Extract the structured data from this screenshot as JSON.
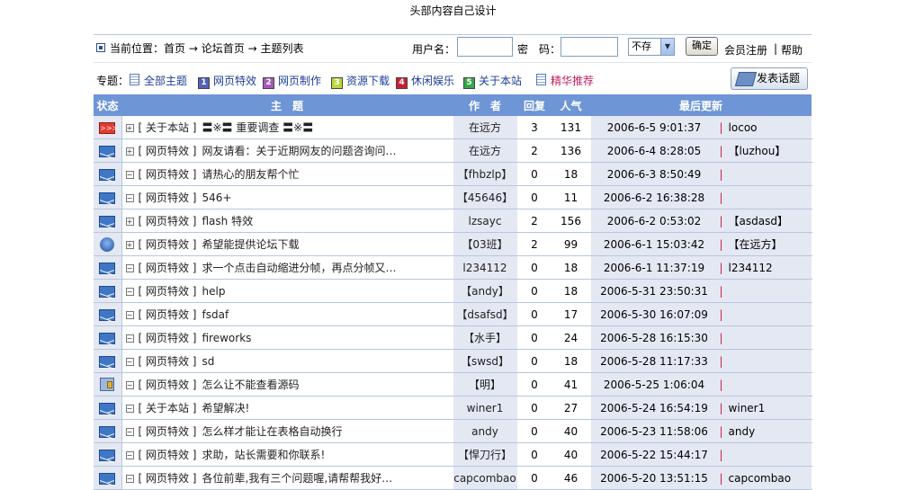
{
  "header": {
    "banner": "头部内容自己设计"
  },
  "nav": {
    "location_label": "当前位置：",
    "home": "首页",
    "arrow": "→",
    "forum_home": "论坛首页",
    "topic_list": "主题列表"
  },
  "login": {
    "username_label": "用户名：",
    "username_value": "",
    "password_label": "密　码：",
    "password_value": "",
    "save_select": "不存",
    "confirm_button": "确定",
    "register_link": "会员注册",
    "divider": "|",
    "help_link": "帮助"
  },
  "topics": {
    "label": "专题：",
    "items": [
      {
        "label": "全部主题",
        "badge": "",
        "color": "#ffffff"
      },
      {
        "label": "网页特效",
        "badge": "1",
        "color": "#5260b8"
      },
      {
        "label": "网页制作",
        "badge": "2",
        "color": "#a45ab9"
      },
      {
        "label": "资源下载",
        "badge": "3",
        "color": "#b8d838"
      },
      {
        "label": "休闲娱乐",
        "badge": "4",
        "color": "#cc2030"
      },
      {
        "label": "关于本站",
        "badge": "5",
        "color": "#36a84a"
      },
      {
        "label": "精华推荐",
        "badge": "",
        "color": "#c02060"
      }
    ],
    "post_button": "发表话题"
  },
  "table": {
    "headers": {
      "status": "状态",
      "subject": "主　题",
      "author": "作　者",
      "replies": "回复",
      "views": "人气",
      "last": "最后更新"
    },
    "rows": [
      {
        "icon": "hot-icon",
        "expand": "+",
        "tag": "[ 关于本站 ]",
        "title": "〓※〓 重要调查 〓※〓",
        "author": "在远方",
        "replies": "3",
        "views": "131",
        "time": "2006-6-5 9:01:37",
        "sep": "|",
        "last_user": "locoo"
      },
      {
        "icon": "mail-icon",
        "expand": "+",
        "tag": "[ 网页特效 ]",
        "title": "网友请看：关于近期网友的问题咨询问…",
        "author": "在远方",
        "replies": "2",
        "views": "136",
        "time": "2006-6-4 8:28:05",
        "sep": "|",
        "last_user": "【luzhou】"
      },
      {
        "icon": "mail-icon",
        "expand": "−",
        "tag": "[ 网页特效 ]",
        "title": "请热心的朋友帮个忙",
        "author": "【fhbzlp】",
        "replies": "0",
        "views": "18",
        "time": "2006-6-3 8:50:49",
        "sep": "|",
        "last_user": ""
      },
      {
        "icon": "mail-icon",
        "expand": "−",
        "tag": "[ 网页特效 ]",
        "title": "546+",
        "author": "【45646】",
        "replies": "0",
        "views": "11",
        "time": "2006-6-2 16:38:28",
        "sep": "|",
        "last_user": ""
      },
      {
        "icon": "mail-icon",
        "expand": "+",
        "tag": "[ 网页特效 ]",
        "title": "flash 特效",
        "author": "lzsayc",
        "replies": "2",
        "views": "156",
        "time": "2006-6-2 0:53:02",
        "sep": "|",
        "last_user": "【asdasd】"
      },
      {
        "icon": "vote-icon",
        "expand": "+",
        "tag": "[ 网页特效 ]",
        "title": "希望能提供论坛下载",
        "author": "【03班】",
        "replies": "2",
        "views": "99",
        "time": "2006-6-1 15:03:42",
        "sep": "|",
        "last_user": "【在远方】"
      },
      {
        "icon": "mail-icon",
        "expand": "−",
        "tag": "[ 网页特效 ]",
        "title": "求一个点击自动缩进分帧，再点分帧又…",
        "author": "l234112",
        "replies": "0",
        "views": "18",
        "time": "2006-6-1 11:37:19",
        "sep": "|",
        "last_user": "l234112"
      },
      {
        "icon": "mail-icon",
        "expand": "−",
        "tag": "[ 网页特效 ]",
        "title": "help",
        "author": "【andy】",
        "replies": "0",
        "views": "18",
        "time": "2006-5-31 23:50:31",
        "sep": "|",
        "last_user": ""
      },
      {
        "icon": "mail-icon",
        "expand": "−",
        "tag": "[ 网页特效 ]",
        "title": "fsdaf",
        "author": "【dsafsd】",
        "replies": "0",
        "views": "17",
        "time": "2006-5-30 16:07:09",
        "sep": "|",
        "last_user": ""
      },
      {
        "icon": "mail-icon",
        "expand": "−",
        "tag": "[ 网页特效 ]",
        "title": "fireworks",
        "author": "【水手】",
        "replies": "0",
        "views": "24",
        "time": "2006-5-28 16:15:30",
        "sep": "|",
        "last_user": ""
      },
      {
        "icon": "mail-icon",
        "expand": "−",
        "tag": "[ 网页特效 ]",
        "title": "sd",
        "author": "【swsd】",
        "replies": "0",
        "views": "18",
        "time": "2006-5-28 11:17:33",
        "sep": "|",
        "last_user": ""
      },
      {
        "icon": "locked-icon",
        "expand": "−",
        "tag": "[ 网页特效 ]",
        "title": "怎么让不能查看源码",
        "author": "【明】",
        "replies": "0",
        "views": "41",
        "time": "2006-5-25 1:06:04",
        "sep": "|",
        "last_user": ""
      },
      {
        "icon": "mail-icon",
        "expand": "−",
        "tag": "[ 关于本站 ]",
        "title": "希望解决!",
        "author": "winer1",
        "replies": "0",
        "views": "27",
        "time": "2006-5-24 16:54:19",
        "sep": "|",
        "last_user": "winer1"
      },
      {
        "icon": "mail-icon",
        "expand": "−",
        "tag": "[ 网页特效 ]",
        "title": "怎么样才能让在表格自动换行",
        "author": "andy",
        "replies": "0",
        "views": "40",
        "time": "2006-5-23 11:58:06",
        "sep": "|",
        "last_user": "andy"
      },
      {
        "icon": "mail-icon",
        "expand": "−",
        "tag": "[ 网页特效 ]",
        "title": "求助，站长需要和你联系!",
        "author": "【悍刀行】",
        "replies": "0",
        "views": "40",
        "time": "2006-5-22 15:44:17",
        "sep": "|",
        "last_user": ""
      },
      {
        "icon": "mail-icon",
        "expand": "−",
        "tag": "[ 网页特效 ]",
        "title": "各位前辈,我有三个问题喔,请帮帮我好…",
        "author": "capcombao",
        "replies": "0",
        "views": "46",
        "time": "2006-5-20 13:51:15",
        "sep": "|",
        "last_user": "capcombao"
      }
    ]
  }
}
